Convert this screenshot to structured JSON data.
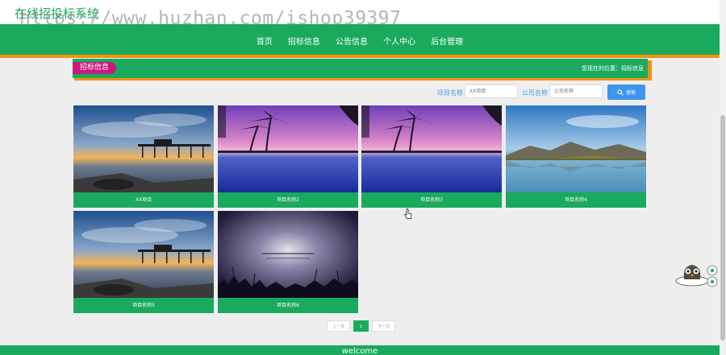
{
  "site": {
    "title": "在线招投标系统",
    "watermark": "https://www.huzhan.com/ishop39397"
  },
  "nav": {
    "items": [
      "首页",
      "招标信息",
      "公告信息",
      "个人中心",
      "后台管理"
    ]
  },
  "breadcrumb": {
    "tag": "招标信息",
    "location": "您现在的位置：招标信息"
  },
  "search": {
    "project_label": "项目名称",
    "project_placeholder": "XX项目",
    "company_label": "公司名称",
    "company_placeholder": "公司名称",
    "button_label": "搜索"
  },
  "cards": [
    {
      "caption": "XX项目",
      "scene": "sunset-pier"
    },
    {
      "caption": "项目名称2",
      "scene": "pink-palms"
    },
    {
      "caption": "项目名称3",
      "scene": "pink-palms"
    },
    {
      "caption": "项目名称4",
      "scene": "mountain-lake"
    },
    {
      "caption": "项目名称5",
      "scene": "sunset-pier"
    },
    {
      "caption": "项目名称6",
      "scene": "night-meadow"
    }
  ],
  "pagination": {
    "prev": "上一页",
    "current": "1",
    "next": "下一页"
  },
  "footer": {
    "text": "welcome"
  },
  "colors": {
    "primary_green": "#1aaa5e",
    "orange": "#f29111",
    "magenta": "#c61a7a",
    "blue": "#3d95ef"
  }
}
